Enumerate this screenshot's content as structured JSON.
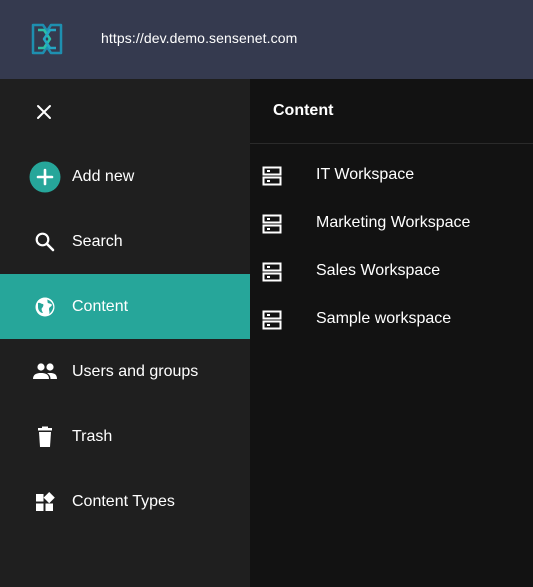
{
  "header": {
    "url": "https://dev.demo.sensenet.com",
    "logo_icon": "sensenet-logo-icon"
  },
  "colors": {
    "topbar": "#353a4f",
    "drawer": "#1f1f1f",
    "accent": "#26a69a",
    "panel": "#121212"
  },
  "drawer": {
    "close_icon": "close-icon",
    "items": [
      {
        "label": "Add new",
        "icon": "add-circle-icon",
        "active": false
      },
      {
        "label": "Search",
        "icon": "search-icon",
        "active": false
      },
      {
        "label": "Content",
        "icon": "globe-icon",
        "active": true
      },
      {
        "label": "Users and groups",
        "icon": "people-icon",
        "active": false
      },
      {
        "label": "Trash",
        "icon": "trash-icon",
        "active": false
      },
      {
        "label": "Content Types",
        "icon": "widgets-icon",
        "active": false
      }
    ]
  },
  "content": {
    "title": "Content",
    "workspaces": [
      {
        "label": "IT Workspace",
        "icon": "workspace-icon"
      },
      {
        "label": "Marketing Workspace",
        "icon": "workspace-icon"
      },
      {
        "label": "Sales Workspace",
        "icon": "workspace-icon"
      },
      {
        "label": "Sample workspace",
        "icon": "workspace-icon"
      }
    ]
  }
}
